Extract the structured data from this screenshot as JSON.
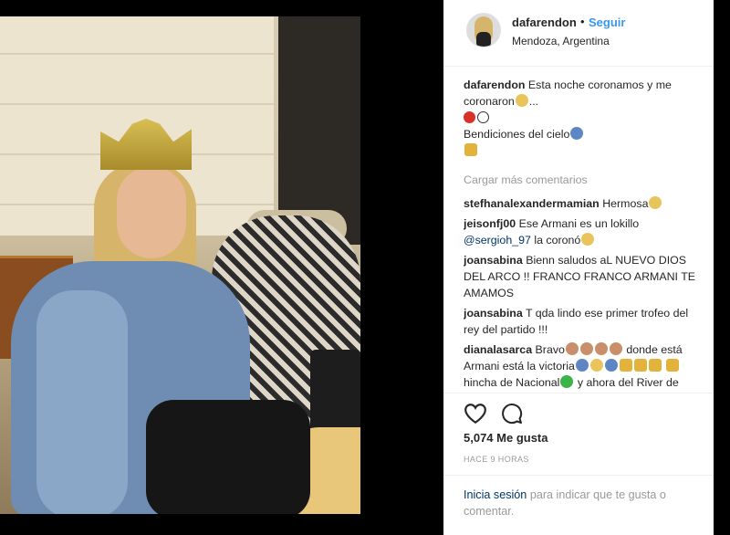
{
  "post": {
    "username": "dafarendon",
    "separator": "•",
    "follow_label": "Seguir",
    "location": "Mendoza, Argentina"
  },
  "caption": {
    "user": "dafarendon",
    "text_line1": "Esta noche coronamos y me",
    "text_line2": "coronaron",
    "ellipsis": "...",
    "blessing": "Bendiciones del cielo"
  },
  "load_more_label": "Cargar más comentarios",
  "comments": [
    {
      "user": "stefhanalexandermamian",
      "text": "Hermosa"
    },
    {
      "user": "jeisonfj00",
      "text": "Ese Armani es un lokillo",
      "mention": "@sergioh_97",
      "text2": "la coronó"
    },
    {
      "user": "joansabina",
      "text": "Bienn saludos aL NUEVO DIOS DEL ARCO !! FRANCO FRANCO ARMANI TE AMAMOS"
    },
    {
      "user": "joansabina",
      "text": "T qda lindo ese primer trofeo del rey del partido !!!"
    },
    {
      "user": "dianalasarca",
      "text": "Bravo",
      "text2": "donde está Armani está la victoria",
      "text3": "hincha de Nacional",
      "text4": "y ahora del River de todo el corazón"
    }
  ],
  "likes": "5,074 Me gusta",
  "timestamp": "HACE 9 HORAS",
  "login": {
    "link": "Inicia sesión",
    "text": "para indicar que te gusta o comentar."
  },
  "colors": {
    "accent": "#3897f0",
    "link": "#003569",
    "muted": "#999999",
    "text": "#262626"
  },
  "icons": [
    "heart-icon",
    "comment-icon"
  ]
}
